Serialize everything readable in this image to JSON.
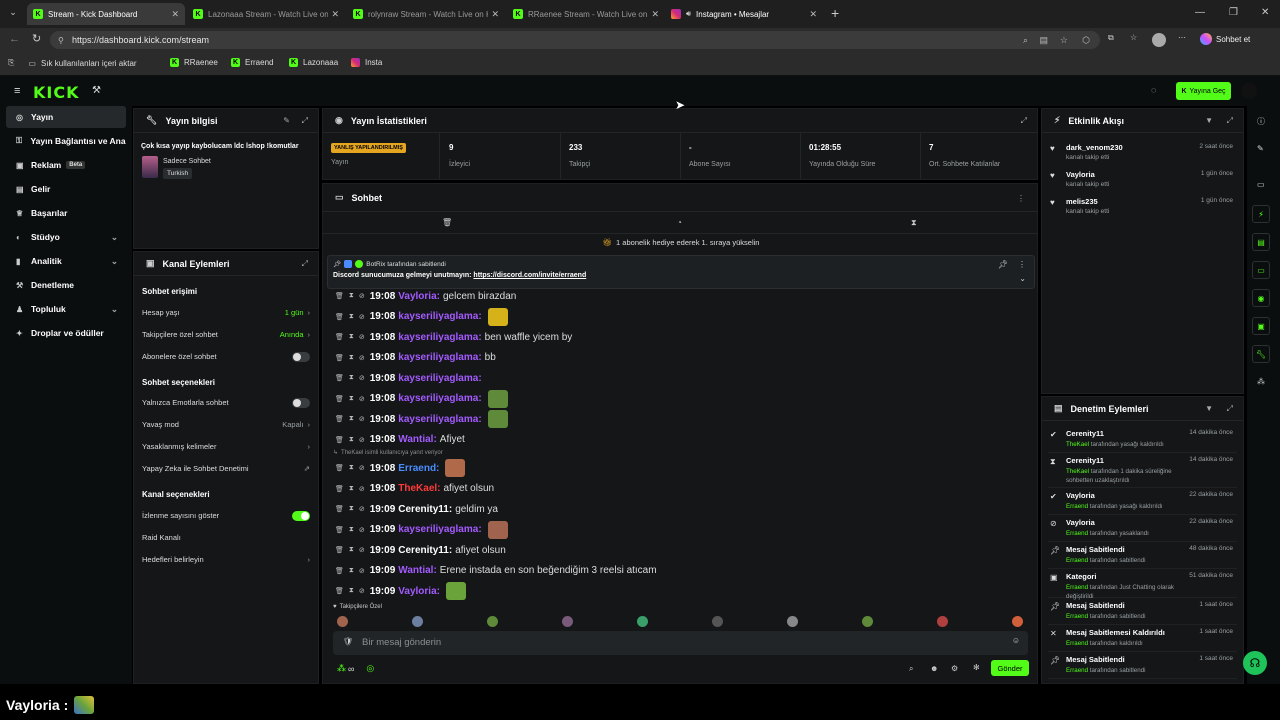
{
  "browser": {
    "tabs": [
      {
        "title": "Stream - Kick Dashboard",
        "favicon": "kick",
        "active": true
      },
      {
        "title": "Lazonaaa Stream - Watch Live on Kick",
        "favicon": "kick",
        "active": false
      },
      {
        "title": "rolynraw Stream - Watch Live on Kick",
        "favicon": "kick",
        "active": false
      },
      {
        "title": "RRaenee Stream - Watch Live on Kick",
        "favicon": "kick",
        "active": false
      },
      {
        "title": "Instagram • Mesajlar",
        "favicon": "instagram",
        "active": false
      }
    ],
    "url": "https://dashboard.kick.com/stream",
    "profile_button": "Sohbet et",
    "bookmarks": [
      "Sık kullanılanları içeri aktar",
      "RRaenee",
      "Erraend",
      "Lazonaaa",
      "Insta"
    ]
  },
  "header": {
    "logo": "KICK",
    "go_live": "Yayına Geç"
  },
  "sidebar": {
    "items": [
      "Yayın",
      "Yayın Bağlantısı ve Anahtarı",
      "Reklam",
      "Gelir",
      "Başarılar",
      "Stüdyo",
      "Analitik",
      "Denetleme",
      "Topluluk",
      "Droplar ve ödüller"
    ],
    "beta": "Beta"
  },
  "stream_info": {
    "title": "Yayın bilgisi",
    "stream_title": "Çok kısa yayıp kaybolucam ldc lshop !komutlar",
    "category": "Sadece Sohbet",
    "language": "Turkish"
  },
  "channel_actions": {
    "title": "Kanal Eylemleri",
    "chat_access": "Sohbet erişimi",
    "account_age": "Hesap yaşı",
    "account_age_value": "1 gün",
    "followers_only": "Takipçilere özel sohbet",
    "followers_only_value": "Anında",
    "subs_only": "Abonelere özel sohbet",
    "chat_options": "Sohbet seçenekleri",
    "emote_only": "Yalnızca Emotlarla sohbet",
    "slow_mode": "Yavaş mod",
    "slow_mode_value": "Kapalı",
    "banned_words": "Yasaklanmış kelimeler",
    "ai_moderation": "Yapay Zeka ile Sohbet Denetimi",
    "channel_options": "Kanal seçenekleri",
    "show_viewers": "İzlenme sayısını göster",
    "raid": "Raid Kanalı",
    "goals": "Hedefleri belirleyin"
  },
  "stats": {
    "title": "Yayın İstatistikleri",
    "warning": "YANLIŞ YAPILANDIRILMIŞ",
    "items": [
      {
        "value": "",
        "label": "Yayın"
      },
      {
        "value": "9",
        "label": "İzleyici"
      },
      {
        "value": "233",
        "label": "Takipçi"
      },
      {
        "value": "-",
        "label": "Abone Sayısı"
      },
      {
        "value": "01:28:55",
        "label": "Yayında Olduğu Süre"
      },
      {
        "value": "7",
        "label": "Ort. Sohbete Katılanlar"
      }
    ]
  },
  "chat": {
    "title": "Sohbet",
    "gift_banner": "1 abonelik hediye ederek 1. sıraya yükselin",
    "pinned_by": "BotRix tarafından sabitlendi",
    "pinned_text": "Discord sunucumuza gelmeyi unutmayın: ",
    "pinned_link": "https://discord.com/invite/erraend",
    "reply_note": "TheKael isimli kullanıcıya yanıt veriyor",
    "messages": [
      {
        "time": "19:08",
        "user": "Vayloria",
        "color": "#a45bff",
        "text": "gelcem birazdan"
      },
      {
        "time": "19:08",
        "user": "kayseriliyaglama",
        "color": "#a45bff",
        "text": "",
        "emote": "#d6b21a"
      },
      {
        "time": "19:08",
        "user": "kayseriliyaglama",
        "color": "#a45bff",
        "text": "ben waffle yicem by"
      },
      {
        "time": "19:08",
        "user": "kayseriliyaglama",
        "color": "#a45bff",
        "text": "bb"
      },
      {
        "time": "19:08",
        "user": "kayseriliyaglama",
        "color": "#a45bff",
        "text": ""
      },
      {
        "time": "19:08",
        "user": "kayseriliyaglama",
        "color": "#a45bff",
        "text": "",
        "emote": "#5e8a3a"
      },
      {
        "time": "19:08",
        "user": "kayseriliyaglama",
        "color": "#a45bff",
        "text": "",
        "emote": "#5e8a3a"
      },
      {
        "time": "19:08",
        "user": "Wantial",
        "color": "#a45bff",
        "text": "Afiyet"
      },
      {
        "time": "19:08",
        "user": "Erraend",
        "color": "#4a8cff",
        "text": "",
        "emote": "#b06a4a"
      },
      {
        "time": "19:08",
        "user": "TheKael",
        "color": "#ff3a3a",
        "text": "afiyet olsun"
      },
      {
        "time": "19:09",
        "user": "Cerenity11",
        "color": "#ffffff",
        "text": "geldim ya"
      },
      {
        "time": "19:09",
        "user": "kayseriliyaglama",
        "color": "#a45bff",
        "text": "",
        "emote": "#a0644e"
      },
      {
        "time": "19:09",
        "user": "Cerenity11",
        "color": "#ffffff",
        "text": "afiyet olsun"
      },
      {
        "time": "19:09",
        "user": "Wantial",
        "color": "#a45bff",
        "text": "Erene instada en son beğendiğim 3 reelsi atıcam"
      },
      {
        "time": "19:09",
        "user": "Vayloria",
        "color": "#a45bff",
        "text": "",
        "emote": "#6aa33a"
      }
    ],
    "followers_only_label": "Takipçilere Özel",
    "input_placeholder": "Bir mesaj gönderin",
    "send": "Gönder",
    "counter": "∞"
  },
  "activity": {
    "title": "Etkinlik Akışı",
    "items": [
      {
        "user": "dark_venom230",
        "desc": "kanalı takip etti",
        "time": "2 saat önce"
      },
      {
        "user": "Vayloria",
        "desc": "kanalı takip etti",
        "time": "1 gün önce"
      },
      {
        "user": "melis235",
        "desc": "kanalı takip etti",
        "time": "1 gün önce"
      }
    ]
  },
  "moderation": {
    "title": "Denetim Eylemleri",
    "items": [
      {
        "user": "Cerenity11",
        "actor": "TheKael",
        "desc": " tarafından yasağı kaldırıldı",
        "time": "14 dakika önce",
        "icon": "check-circle-icon"
      },
      {
        "user": "Cerenity11",
        "actor": "TheKael",
        "desc": " tarafından 1 dakika süreliğine sohbetten uzaklaştırıldı",
        "time": "14 dakika önce",
        "icon": "hourglass-icon"
      },
      {
        "user": "Vayloria",
        "actor": "Erraend",
        "desc": " tarafından yasağı kaldırıldı",
        "time": "22 dakika önce",
        "icon": "check-circle-icon"
      },
      {
        "user": "Vayloria",
        "actor": "Erraend",
        "desc": " tarafından yasaklandı",
        "time": "22 dakika önce",
        "icon": "ban-icon"
      },
      {
        "user": "Mesaj Sabitlendi",
        "actor": "Erraend",
        "desc": " tarafından sabitlendi",
        "time": "48 dakika önce",
        "icon": "pin-icon"
      },
      {
        "user": "Kategori",
        "actor": "Erraend",
        "desc": " tarafından Just Chatting olarak değiştirildi",
        "time": "51 dakika önce",
        "icon": "category-icon"
      },
      {
        "user": "Mesaj Sabitlendi",
        "actor": "Erraend",
        "desc": " tarafından sabitlendi",
        "time": "1 saat önce",
        "icon": "pin-icon"
      },
      {
        "user": "Mesaj Sabitlemesi Kaldırıldı",
        "actor": "Erraend",
        "desc": " tarafından kaldırıldı",
        "time": "1 saat önce",
        "icon": "unpin-icon"
      },
      {
        "user": "Mesaj Sabitlendi",
        "actor": "Erraend",
        "desc": " tarafından sabitlendi",
        "time": "1 saat önce",
        "icon": "pin-icon"
      }
    ]
  },
  "overlay": {
    "text": "Vayloria :"
  }
}
